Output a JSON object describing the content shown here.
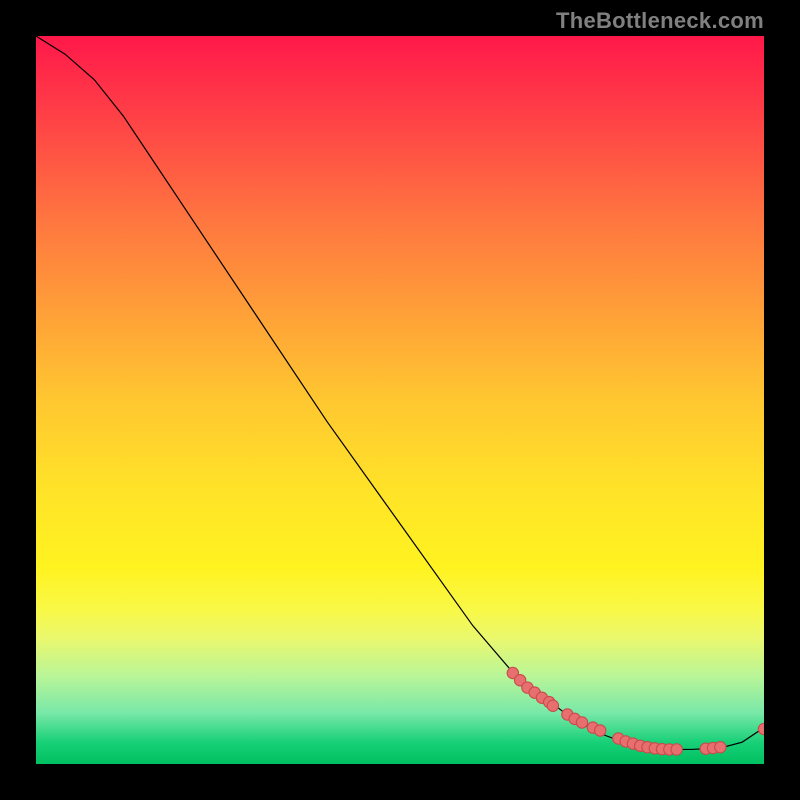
{
  "attribution": "TheBottleneck.com",
  "colors": {
    "line": "#000000",
    "point_fill": "#e76f6f",
    "point_stroke": "#c94b4b",
    "background": "#000000"
  },
  "chart_data": {
    "type": "line",
    "title": "",
    "xlabel": "",
    "ylabel": "",
    "xlim": [
      0,
      100
    ],
    "ylim": [
      0,
      100
    ],
    "series": [
      {
        "name": "curve",
        "x": [
          0,
          4,
          8,
          12,
          16,
          20,
          30,
          40,
          50,
          60,
          66,
          70,
          74,
          78,
          82,
          86,
          90,
          94,
          97,
          100
        ],
        "y": [
          100,
          97.5,
          94,
          89,
          83,
          77,
          62,
          47,
          33,
          19,
          12,
          9,
          6,
          4,
          2.5,
          2,
          2,
          2.2,
          3,
          5
        ]
      }
    ],
    "scatter_points": {
      "x": [
        65.5,
        66.5,
        67.5,
        68.5,
        69.5,
        70.5,
        71,
        73,
        74,
        75,
        76.5,
        77.5,
        80,
        81,
        82,
        83,
        84,
        85,
        86,
        87,
        88,
        92,
        93,
        94,
        100
      ],
      "y": [
        12.5,
        11.5,
        10.5,
        9.8,
        9.1,
        8.5,
        8.0,
        6.8,
        6.2,
        5.7,
        5.0,
        4.6,
        3.5,
        3.1,
        2.8,
        2.5,
        2.3,
        2.15,
        2.05,
        2.0,
        2.0,
        2.1,
        2.2,
        2.3,
        4.8
      ]
    }
  }
}
